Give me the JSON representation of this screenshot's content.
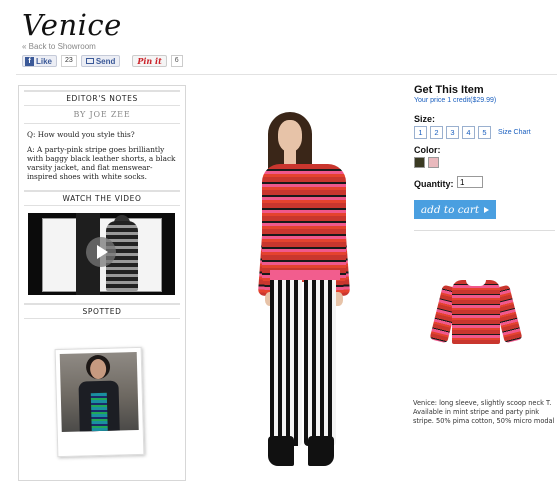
{
  "page": {
    "title": "Venice",
    "back_link": "« Back to Showroom"
  },
  "social": {
    "like_label": "Like",
    "like_count": "23",
    "send_label": "Send",
    "pin_label": "Pin it",
    "pin_count": "6"
  },
  "sidebar": {
    "editors_notes_heading": "EDITOR'S NOTES",
    "byline": "BY JOE ZEE",
    "question": "Q: How would you style this?",
    "answer": "A: A party-pink stripe goes brilliantly with baggy black leather shorts, a black varsity jacket, and flat menswear-inspired shoes with white socks.",
    "video_heading": "WATCH THE VIDEO",
    "spotted_heading": "SPOTTED"
  },
  "purchase": {
    "heading": "Get This Item",
    "price_line": "Your price 1 credit($29.99)",
    "size_label": "Size:",
    "sizes": [
      "1",
      "2",
      "3",
      "4",
      "5"
    ],
    "size_chart_link": "Size Chart",
    "color_label": "Color:",
    "colors": [
      "#3a3a22",
      "#e9b9bd"
    ],
    "quantity_label": "Quantity:",
    "quantity_value": "1",
    "add_to_cart": "add to cart"
  },
  "product": {
    "description": "Venice: long sleeve, slightly scoop neck T. Available in mint stripe and party pink stripe. 50% pima cotton, 50% micro modal"
  }
}
